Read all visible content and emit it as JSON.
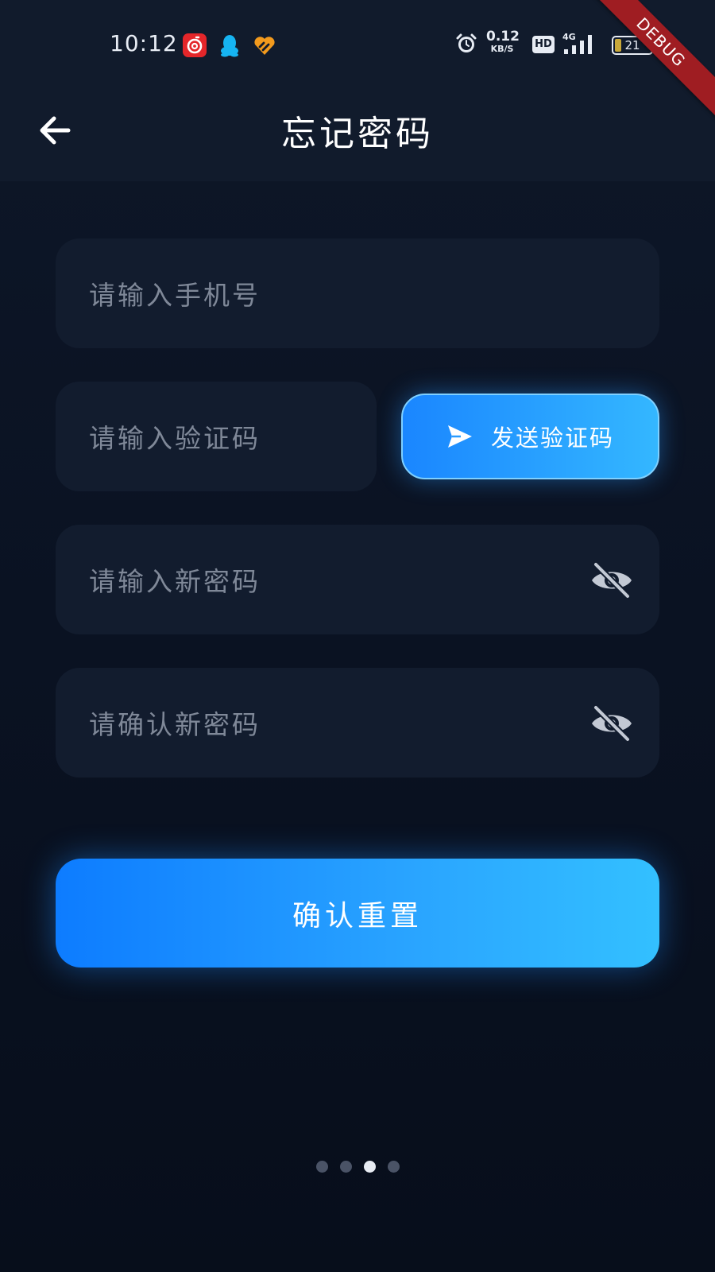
{
  "status_bar": {
    "time": "10:12",
    "net_speed_value": "0.12",
    "net_speed_unit": "KB/S",
    "hd_label": "HD",
    "network_label": "4G",
    "battery_level": "21"
  },
  "debug_banner": "DEBUG",
  "app_bar": {
    "title": "忘记密码"
  },
  "form": {
    "phone_placeholder": "请输入手机号",
    "code_placeholder": "请输入验证码",
    "send_code_label": "发送验证码",
    "new_password_placeholder": "请输入新密码",
    "confirm_password_placeholder": "请确认新密码",
    "confirm_button_label": "确认重置"
  },
  "pager": {
    "count": 4,
    "active_index": 2
  },
  "icons": {
    "back": "arrow-left-icon",
    "send": "send-icon",
    "eye_off": "eye-off-icon",
    "alarm": "alarm-icon"
  },
  "colors": {
    "accent_start": "#0d7cff",
    "accent_end": "#33c0ff",
    "field_bg": "#121c2e",
    "page_bg": "#0b1322",
    "debug_red": "#9f1d22"
  }
}
